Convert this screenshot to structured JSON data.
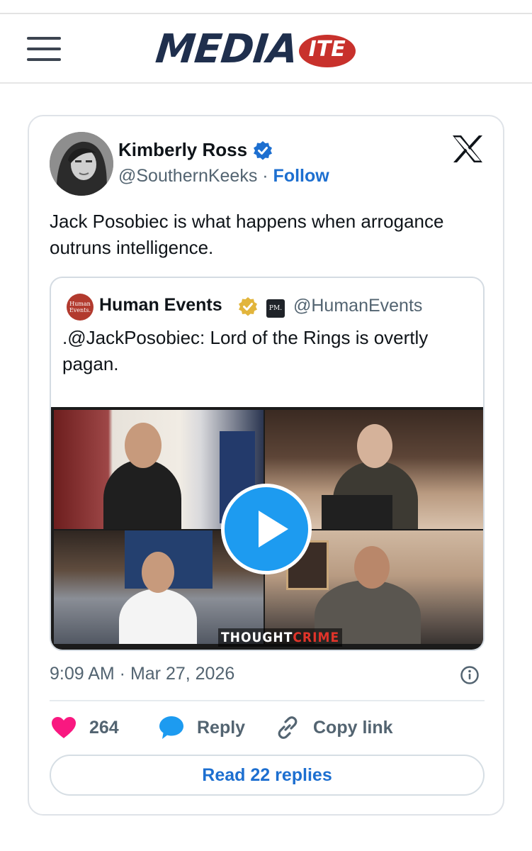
{
  "header": {
    "menu_icon": "hamburger-menu-icon",
    "logo_main": "MEDIA",
    "logo_badge": "ITE",
    "logo_text_color": "#1f2f4d",
    "logo_badge_color": "#c8312c"
  },
  "tweet": {
    "author_name": "Kimberly Ross",
    "handle": "@SouthernKeeks",
    "separator": " · ",
    "follow_label": "Follow",
    "verified_icon": "verified-badge-icon",
    "platform_icon": "x-logo-icon",
    "text": "Jack Posobiec is what happens when arrogance outruns intelligence.",
    "timestamp": "9:09 AM · Mar 27, 2026",
    "info_icon": "info-icon",
    "accent_color": "#1d6fd0"
  },
  "quoted_tweet": {
    "avatar_text": "Human Events.",
    "author_name": "Human Events",
    "gold_badge_icon": "gold-verified-badge-icon",
    "affiliate_badge": "PM.",
    "handle": "@HumanEvents",
    "text": ".@JackPosobiec: Lord of the Rings is overtly pagan.",
    "media": {
      "overlay_white": "THOUGHT",
      "overlay_red": "CRIME",
      "play_icon": "play-button-icon"
    }
  },
  "actions": {
    "like_icon": "heart-icon",
    "like_count": "264",
    "reply_icon": "speech-bubble-icon",
    "reply_label": "Reply",
    "copy_icon": "link-icon",
    "copy_label": "Copy link",
    "read_replies_label": "Read 22 replies"
  }
}
